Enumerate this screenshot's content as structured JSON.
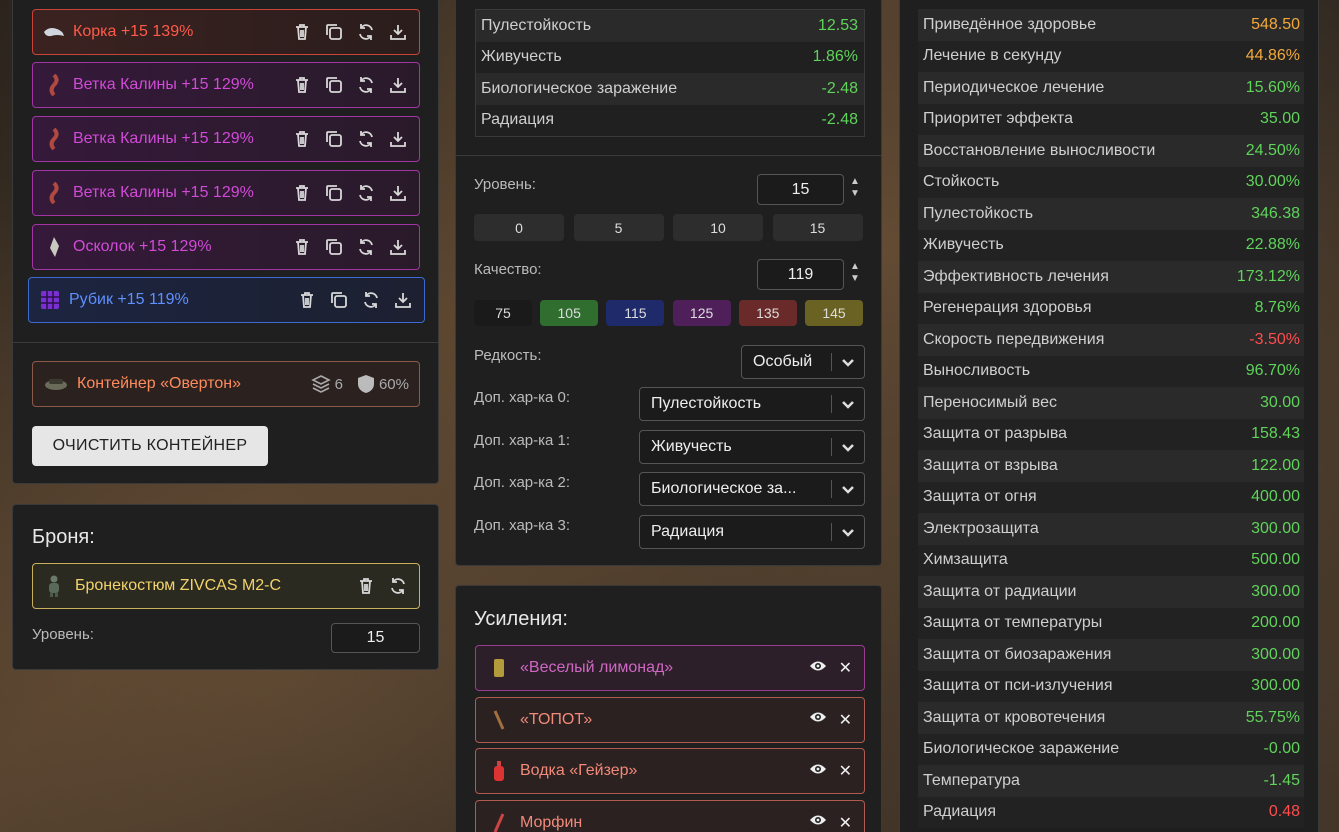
{
  "artifacts": [
    {
      "label": "Корка +15 139%",
      "icon": "bark-artifact-icon",
      "rarity": "red"
    },
    {
      "label": "Ветка Калины +15 129%",
      "icon": "viburnum-branch-icon",
      "rarity": "pink"
    },
    {
      "label": "Ветка Калины +15 129%",
      "icon": "viburnum-branch-icon",
      "rarity": "pink"
    },
    {
      "label": "Ветка Калины +15 129%",
      "icon": "viburnum-branch-icon",
      "rarity": "pink"
    },
    {
      "label": "Осколок +15 129%",
      "icon": "shard-artifact-icon",
      "rarity": "pink"
    },
    {
      "label": "Рубик +15 119%",
      "icon": "rubik-artifact-icon",
      "rarity": "blue"
    }
  ],
  "container": {
    "name": "Контейнер «Овертон»",
    "slots": "6",
    "protection": "60%"
  },
  "clear_button": "ОЧИСТИТЬ КОНТЕЙНЕР",
  "armor": {
    "title": "Броня:",
    "name": "Бронекостюм ZIVCAS M2-C",
    "level_label": "Уровень:",
    "level": "15"
  },
  "artifact_stats": [
    {
      "k": "Пулестойкость",
      "v": "12.53",
      "c": "g"
    },
    {
      "k": "Живучесть",
      "v": "1.86%",
      "c": "g"
    },
    {
      "k": "Биологическое заражение",
      "v": "-2.48",
      "c": "g"
    },
    {
      "k": "Радиация",
      "v": "-2.48",
      "c": "g"
    }
  ],
  "editor": {
    "level_label": "Уровень:",
    "level": "15",
    "level_presets": [
      "0",
      "5",
      "10",
      "15"
    ],
    "quality_label": "Качество:",
    "quality": "119",
    "quality_presets": [
      {
        "v": "75",
        "color": "#1a1a1a"
      },
      {
        "v": "105",
        "color": "#2f6e2f"
      },
      {
        "v": "115",
        "color": "#1f2a6a"
      },
      {
        "v": "125",
        "color": "#4f1f5a"
      },
      {
        "v": "135",
        "color": "#6a2a2a"
      },
      {
        "v": "145",
        "color": "#6a6222"
      }
    ],
    "rarity_label": "Редкость:",
    "rarity": "Особый",
    "extra": [
      {
        "label": "Доп. хар-ка 0:",
        "value": "Пулестойкость"
      },
      {
        "label": "Доп. хар-ка 1:",
        "value": "Живучесть"
      },
      {
        "label": "Доп. хар-ка 2:",
        "value": "Биологическое за..."
      },
      {
        "label": "Доп. хар-ка 3:",
        "value": "Радиация"
      }
    ]
  },
  "boosts": {
    "title": "Усиления:",
    "items": [
      {
        "label": "«Веселый лимонад»",
        "style": "b-pink",
        "icon": "lemonade-can-icon"
      },
      {
        "label": "«ТОПОТ»",
        "style": "b-salmon",
        "icon": "stomp-stick-icon"
      },
      {
        "label": "Водка «Гейзер»",
        "style": "b-salmon",
        "icon": "vodka-bottle-icon"
      },
      {
        "label": "Морфин",
        "style": "b-salmon",
        "icon": "morphine-syringe-icon"
      }
    ]
  },
  "total_stats": [
    {
      "k": "Приведённое здоровье",
      "v": "548.50",
      "c": "o"
    },
    {
      "k": "Лечение в секунду",
      "v": "44.86%",
      "c": "o"
    },
    {
      "k": "Периодическое лечение",
      "v": "15.60%",
      "c": "g"
    },
    {
      "k": "Приоритет эффекта",
      "v": "35.00",
      "c": "g"
    },
    {
      "k": "Восстановление выносливости",
      "v": "24.50%",
      "c": "g"
    },
    {
      "k": "Стойкость",
      "v": "30.00%",
      "c": "g"
    },
    {
      "k": "Пулестойкость",
      "v": "346.38",
      "c": "g"
    },
    {
      "k": "Живучесть",
      "v": "22.88%",
      "c": "g"
    },
    {
      "k": "Эффективность лечения",
      "v": "173.12%",
      "c": "g"
    },
    {
      "k": "Регенерация здоровья",
      "v": "8.76%",
      "c": "g"
    },
    {
      "k": "Скорость передвижения",
      "v": "-3.50%",
      "c": "r"
    },
    {
      "k": "Выносливость",
      "v": "96.70%",
      "c": "g"
    },
    {
      "k": "Переносимый вес",
      "v": "30.00",
      "c": "g"
    },
    {
      "k": "Защита от разрыва",
      "v": "158.43",
      "c": "g"
    },
    {
      "k": "Защита от взрыва",
      "v": "122.00",
      "c": "g"
    },
    {
      "k": "Защита от огня",
      "v": "400.00",
      "c": "g"
    },
    {
      "k": "Электрозащита",
      "v": "300.00",
      "c": "g"
    },
    {
      "k": "Химзащита",
      "v": "500.00",
      "c": "g"
    },
    {
      "k": "Защита от радиации",
      "v": "300.00",
      "c": "g"
    },
    {
      "k": "Защита от температуры",
      "v": "200.00",
      "c": "g"
    },
    {
      "k": "Защита от биозаражения",
      "v": "300.00",
      "c": "g"
    },
    {
      "k": "Защита от пси-излучения",
      "v": "300.00",
      "c": "g"
    },
    {
      "k": "Защита от кровотечения",
      "v": "55.75%",
      "c": "g"
    },
    {
      "k": "Биологическое заражение",
      "v": "-0.00",
      "c": "g"
    },
    {
      "k": "Температура",
      "v": "-1.45",
      "c": "g"
    },
    {
      "k": "Радиация",
      "v": "0.48",
      "c": "r"
    }
  ]
}
